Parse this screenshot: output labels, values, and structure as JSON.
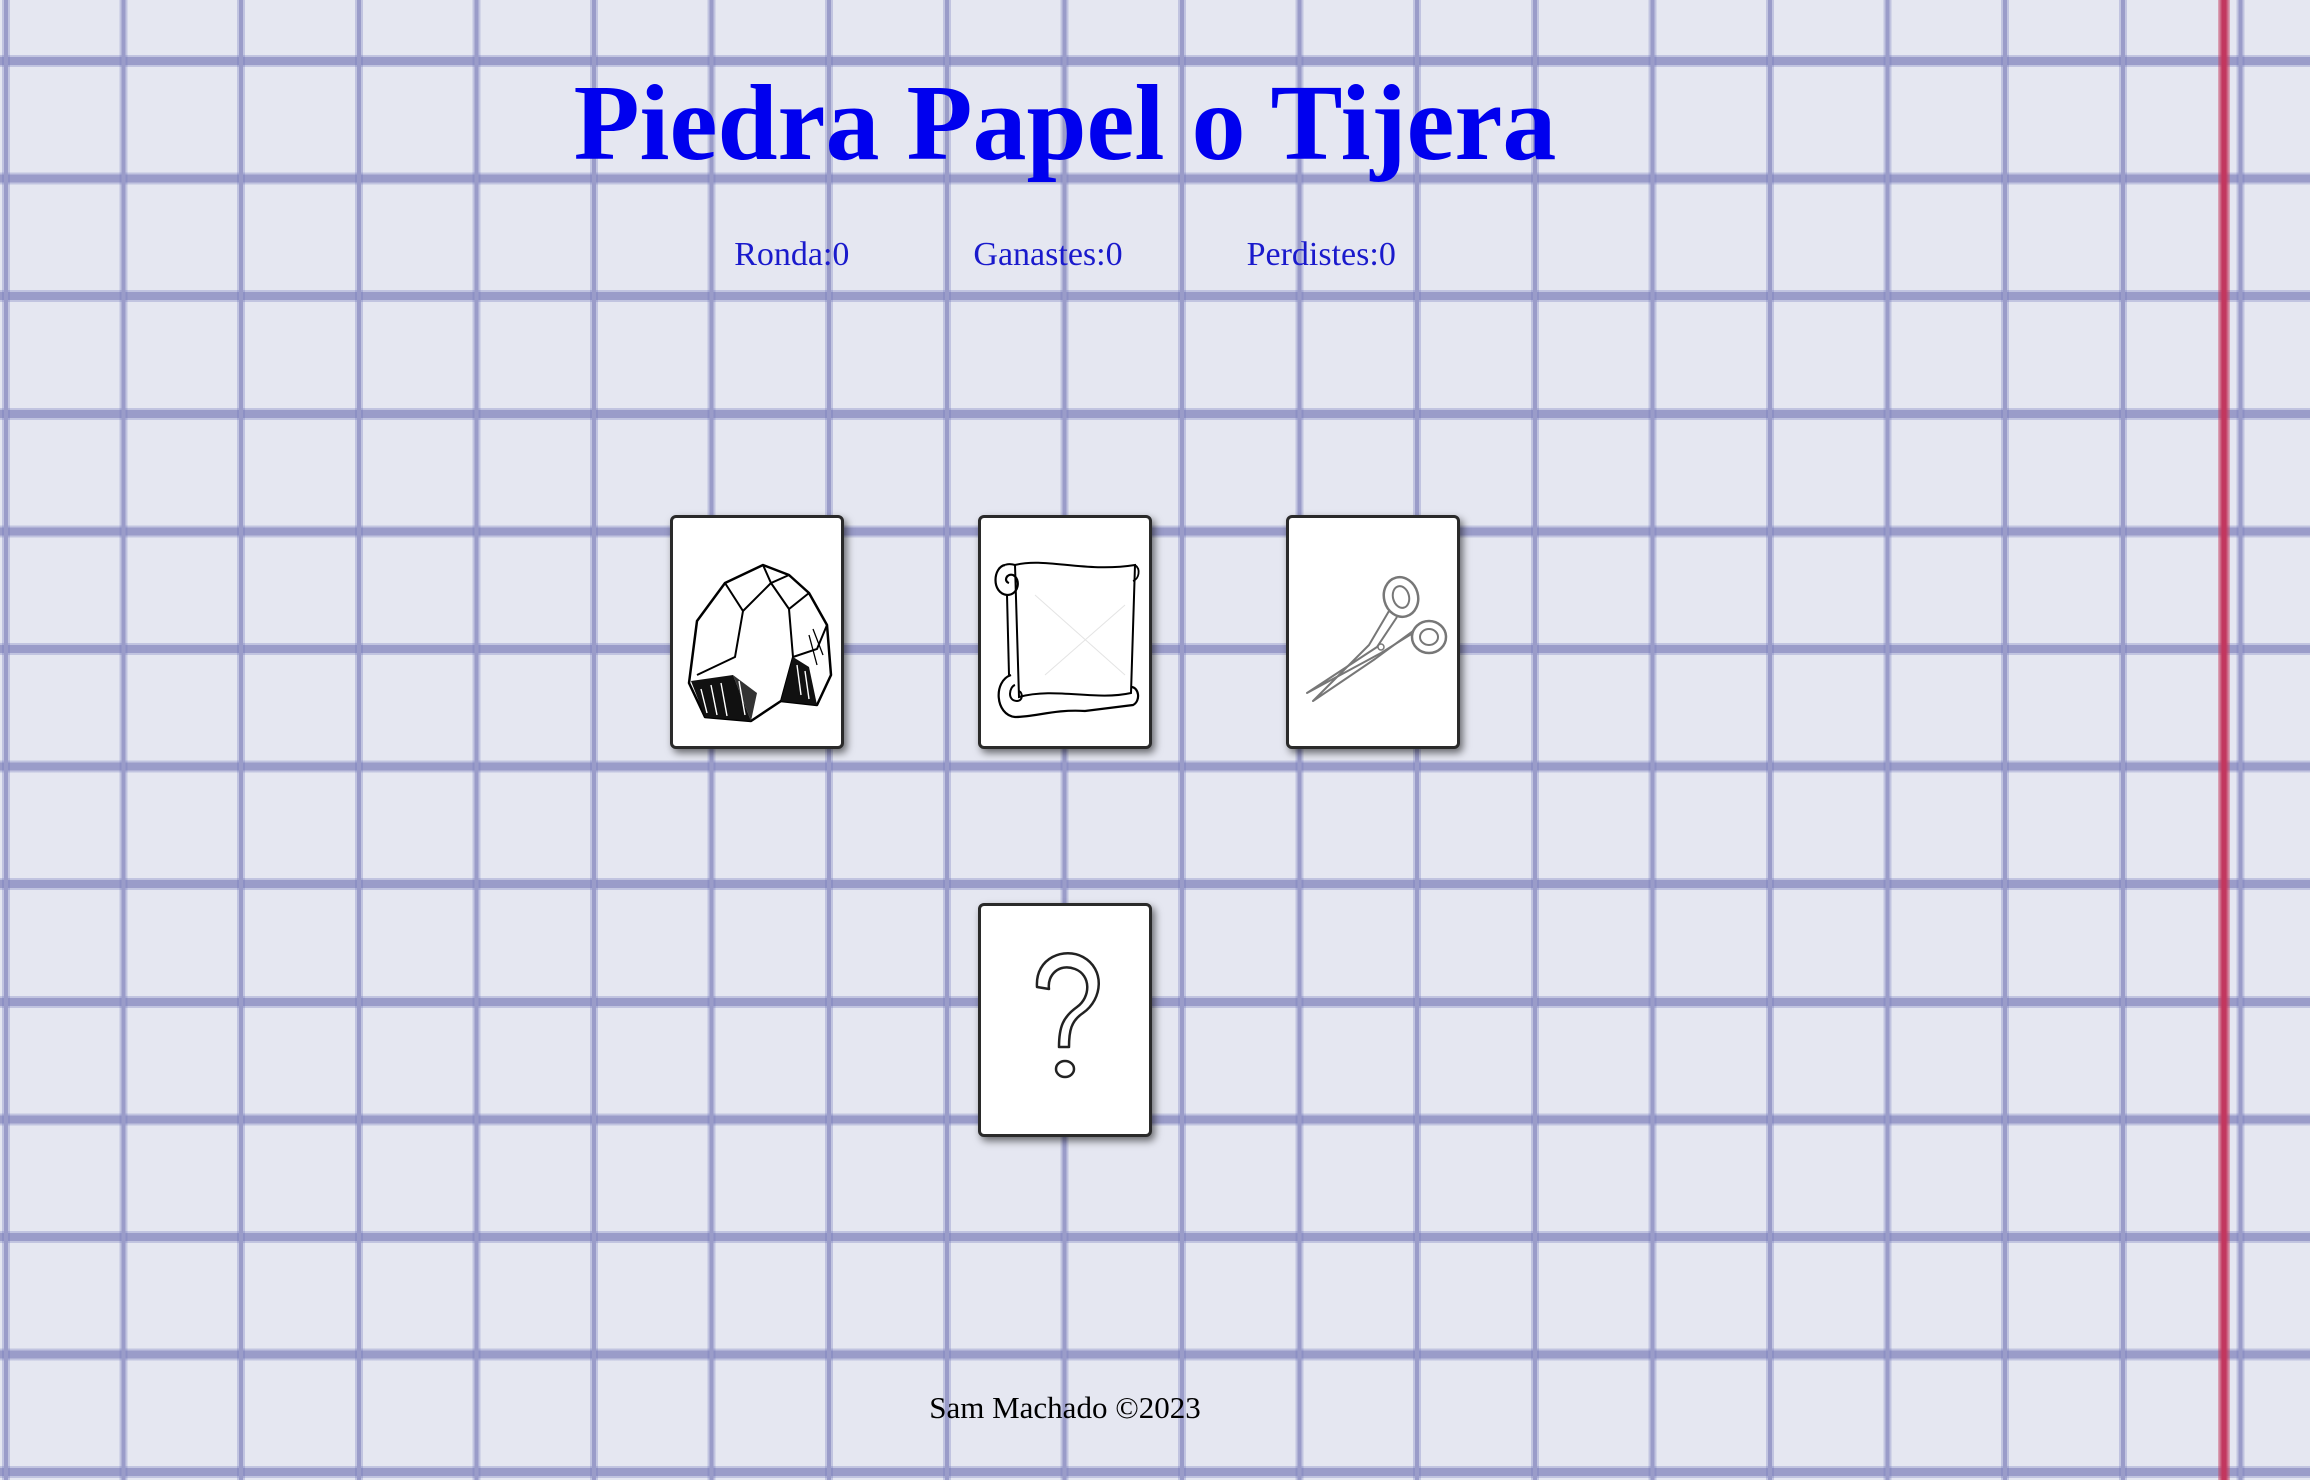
{
  "game": {
    "title": "Piedra Papel o Tijera"
  },
  "scoreboard": {
    "round_label": "Ronda:",
    "round_value": "0",
    "wins_label": "Ganastes:",
    "wins_value": "0",
    "losses_label": "Perdistes:",
    "losses_value": "0"
  },
  "choices": [
    {
      "name": "piedra",
      "icon": "rock-icon"
    },
    {
      "name": "papel",
      "icon": "paper-scroll-icon"
    },
    {
      "name": "tijera",
      "icon": "scissors-icon"
    }
  ],
  "cpu_card": {
    "icon": "question-mark-icon"
  },
  "footer": {
    "text": "Sam Machado ©2023"
  },
  "colors": {
    "title": "#0000ee",
    "score_text": "#1a1acc",
    "grid_line": "#9a9cc9",
    "margin_line": "#c2375f",
    "background": "#e5e7f1"
  }
}
